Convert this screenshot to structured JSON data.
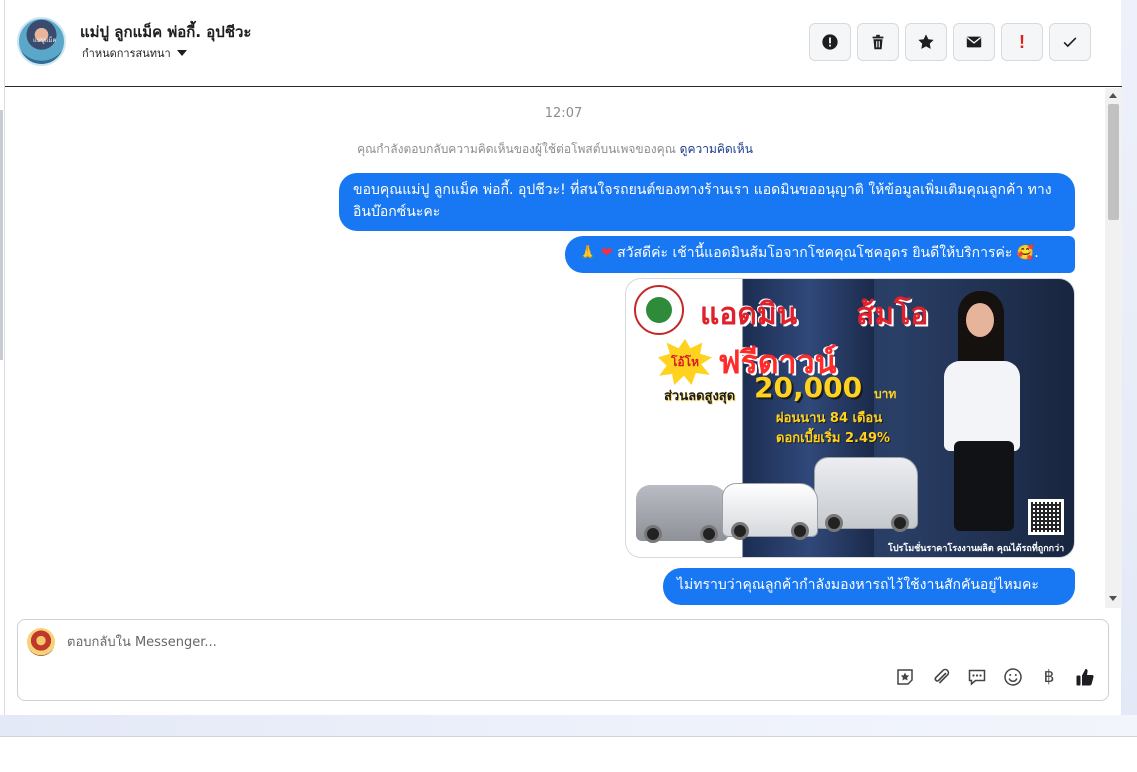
{
  "header": {
    "contact_name": "แม่ปู ลูกแม็ค พ่อกี้. อุปชีวะ",
    "avatar_label": "แม่ปูแม็ค",
    "assign_label": "กำหนดการสนทนา",
    "actions": [
      {
        "name": "spam-icon"
      },
      {
        "name": "trash-icon"
      },
      {
        "name": "star-icon"
      },
      {
        "name": "mail-icon"
      },
      {
        "name": "exclamation-icon",
        "label": "!"
      },
      {
        "name": "check-icon"
      }
    ]
  },
  "conversation": {
    "timestamp": "12:07",
    "notice_text": "คุณกำลังตอบกลับความคิดเห็นของผู้ใช้ต่อโพสต์บนเพจของคุณ",
    "notice_link": "ดูความคิดเห็น",
    "messages": [
      {
        "text": "ขอบคุณแม่ปู ลูกแม็ค พ่อกี้. อุปชีวะ! ที่สนใจรถยนต์ของทางร้านเรา แอดมินขออนุญาติ ให้ข้อมูลเพิ่มเติมคุณลูกค้า ทางอินบ๊อกซ์นะคะ"
      },
      {
        "prefix": "🙏",
        "heart": "❤",
        "text": " สวัสดีค่ะ เช้านี้แอดมินส้มโอจากโชคคุณโชคอุดร ยินดีให้บริการค่ะ 🥰."
      },
      {
        "text": "ไม่ทราบว่าคุณลูกค้ากำลังมองหารถไว้ใช้งานสักคันอยู่ไหมคะ"
      }
    ],
    "promo": {
      "title_left": "แอดมิน",
      "title_right": "ส้มโอ",
      "burst": "โอ้โห",
      "headline": "ฟรีดาวน์",
      "discount_label": "ส่วนลดสูงสุด",
      "amount": "20,000",
      "currency": "บาท",
      "line1": "ผ่อนนาน 84 เดือน",
      "line2": "ดอกเบี้ยเริ่ม 2.49%",
      "footer": "โปรโมชั่นราคาโรงงานผลิต คุณได้รถที่ถูกกว่า"
    }
  },
  "composer": {
    "placeholder": "ตอบกลับใน Messenger...",
    "tools": [
      {
        "name": "sticker-star-icon"
      },
      {
        "name": "paperclip-icon"
      },
      {
        "name": "saved-reply-icon"
      },
      {
        "name": "emoji-icon"
      },
      {
        "name": "baht-icon",
        "label": "฿"
      },
      {
        "name": "thumbs-up-icon"
      }
    ]
  },
  "colors": {
    "bubble": "#1877f2",
    "link": "#1c3d8c",
    "danger": "#e02020"
  }
}
